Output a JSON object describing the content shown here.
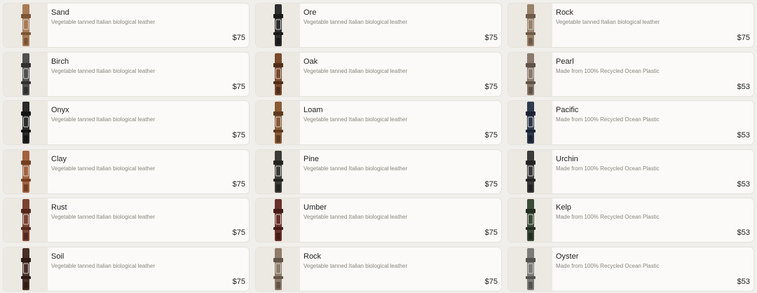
{
  "products": [
    {
      "name": "Sand",
      "description": "Vegetable tanned Italian biological leather",
      "price": "$75",
      "color": "#a97b55",
      "accent": "#7c5535",
      "column": 1
    },
    {
      "name": "Ore",
      "description": "Vegetable tanned Italian biological leather",
      "price": "$75",
      "color": "#2e2e2e",
      "accent": "#1a1a1a",
      "column": 2
    },
    {
      "name": "Rock",
      "description": "Vegetable tanned Italian biological leather",
      "price": "$75",
      "color": "#9a826a",
      "accent": "#6e5a48",
      "column": 3
    },
    {
      "name": "Birch",
      "description": "Vegetable tanned Italian biological leather",
      "price": "$75",
      "color": "#505050",
      "accent": "#2f2f2f",
      "column": 1
    },
    {
      "name": "Oak",
      "description": "Vegetable tanned Italian biological leather",
      "price": "$75",
      "color": "#7a4a2c",
      "accent": "#4f2e1a",
      "column": 2
    },
    {
      "name": "Pearl",
      "description": "Made from 100% Recycled Ocean Plastic",
      "price": "$53",
      "color": "#8a7a6c",
      "accent": "#5f5348",
      "column": 3
    },
    {
      "name": "Onyx",
      "description": "Vegetable tanned Italian biological leather",
      "price": "$75",
      "color": "#2a2a2a",
      "accent": "#141414",
      "column": 1
    },
    {
      "name": "Loam",
      "description": "Vegetable tanned Italian biological leather",
      "price": "$75",
      "color": "#8a5a35",
      "accent": "#5e3b20",
      "column": 2
    },
    {
      "name": "Pacific",
      "description": "Made from 100% Recycled Ocean Plastic",
      "price": "$53",
      "color": "#2f3a4e",
      "accent": "#1b2333",
      "column": 3
    },
    {
      "name": "Clay",
      "description": "Vegetable tanned Italian biological leather",
      "price": "$75",
      "color": "#a3623e",
      "accent": "#733f24",
      "column": 1
    },
    {
      "name": "Pine",
      "description": "Vegetable tanned Italian biological leather",
      "price": "$75",
      "color": "#3d3b36",
      "accent": "#24231f",
      "column": 2
    },
    {
      "name": "Urchin",
      "description": "Made from 100% Recycled Ocean Plastic",
      "price": "$53",
      "color": "#3a3a3a",
      "accent": "#222222",
      "column": 3
    },
    {
      "name": "Rust",
      "description": "Vegetable tanned Italian biological leather",
      "price": "$75",
      "color": "#7c4232",
      "accent": "#52281d",
      "column": 1
    },
    {
      "name": "Umber",
      "description": "Vegetable tanned Italian biological leather",
      "price": "$75",
      "color": "#6a2f2a",
      "accent": "#441b17",
      "column": 2
    },
    {
      "name": "Kelp",
      "description": "Made from 100% Recycled Ocean Plastic",
      "price": "$53",
      "color": "#3a4a36",
      "accent": "#222e20",
      "column": 3
    },
    {
      "name": "Soil",
      "description": "Vegetable tanned Italian biological leather",
      "price": "$75",
      "color": "#4a2f28",
      "accent": "#2e1b16",
      "column": 1
    },
    {
      "name": "Rock",
      "description": "Vegetable tanned Italian biological leather",
      "price": "$75",
      "color": "#8e7b68",
      "accent": "#63544a",
      "column": 2
    },
    {
      "name": "Oyster",
      "description": "Made from 100% Recycled Ocean Plastic",
      "price": "$53",
      "color": "#7d7b78",
      "accent": "#555350",
      "column": 3
    }
  ]
}
